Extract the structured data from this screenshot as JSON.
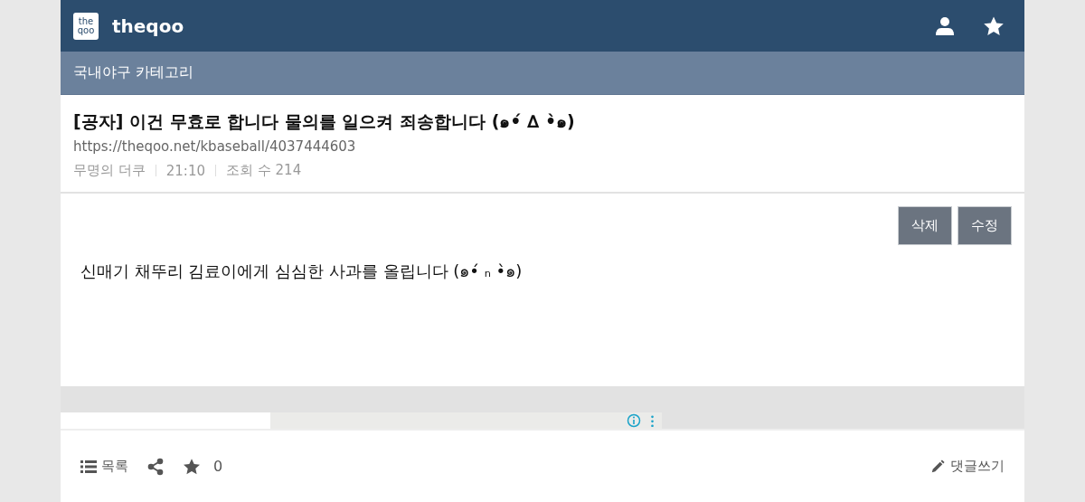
{
  "header": {
    "logo_lines": [
      "the",
      "qoo"
    ],
    "site_name": "theqoo"
  },
  "category": "국내야구 카테고리",
  "post": {
    "title": "[공자] 이건 무효로 합니다 물의를 일으켜 죄송합니다 (๑•́ ∆ •̀๑)",
    "url": "https://theqoo.net/kbaseball/4037444603",
    "meta": [
      "무명의 더쿠",
      "21:10",
      "조회 수 214"
    ],
    "buttons": [
      "삭제",
      "수정"
    ],
    "body": "신매기 채뚜리 김료이에게 심심한 사과를 올립니다 (๑•́ ₙ •̀๑)"
  },
  "footer": {
    "list_label": "목록",
    "star_count": "0",
    "comment_label": "댓글쓰기"
  }
}
